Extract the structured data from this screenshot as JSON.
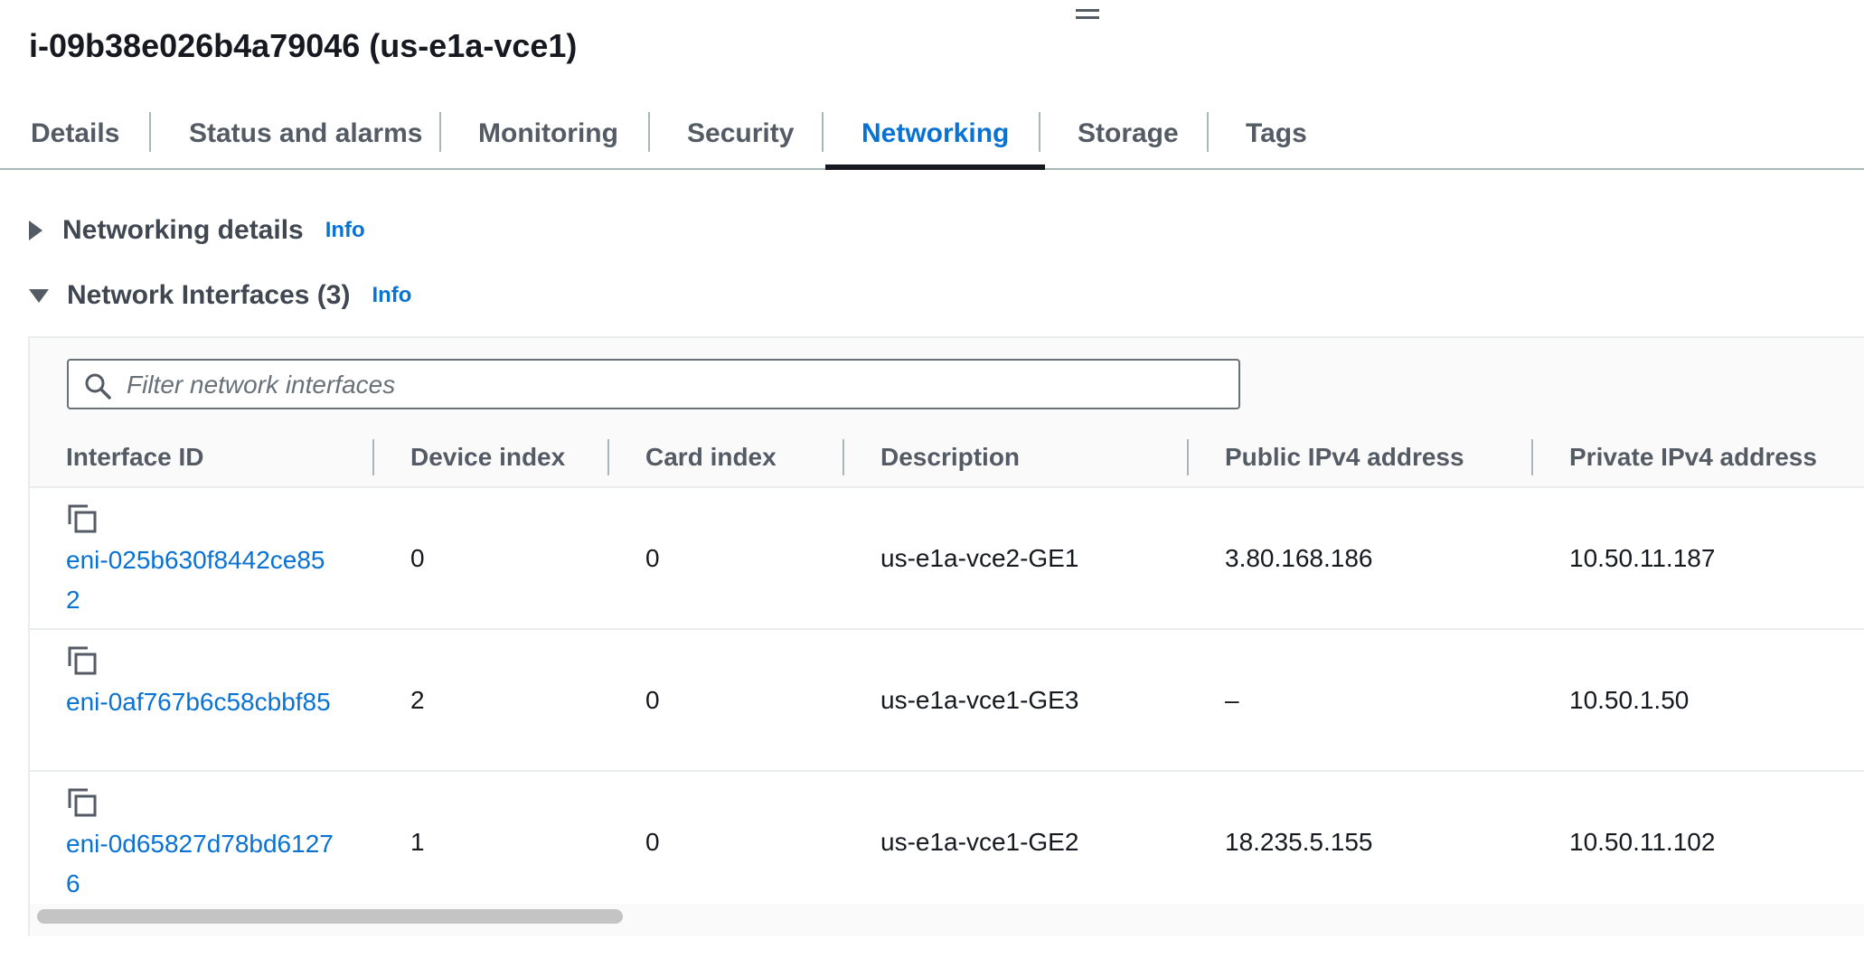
{
  "instance": {
    "title": "i-09b38e026b4a79046 (us-e1a-vce1)"
  },
  "tabs": [
    {
      "label": "Details"
    },
    {
      "label": "Status and alarms"
    },
    {
      "label": "Monitoring"
    },
    {
      "label": "Security"
    },
    {
      "label": "Networking",
      "active": true
    },
    {
      "label": "Storage"
    },
    {
      "label": "Tags"
    }
  ],
  "sections": {
    "networking_details": {
      "label": "Networking details",
      "info": "Info",
      "expanded": false
    },
    "network_interfaces": {
      "label": "Network Interfaces (3)",
      "info": "Info",
      "expanded": true
    }
  },
  "filter": {
    "placeholder": "Filter network interfaces",
    "value": ""
  },
  "table": {
    "columns": [
      "Interface ID",
      "Device index",
      "Card index",
      "Description",
      "Public IPv4 address",
      "Private IPv4 address"
    ],
    "rows": [
      {
        "interface_id": "eni-025b630f8442ce852",
        "device_index": "0",
        "card_index": "0",
        "description": "us-e1a-vce2-GE1",
        "public_ipv4": "3.80.168.186",
        "private_ipv4": "10.50.11.187"
      },
      {
        "interface_id": "eni-0af767b6c58cbbf85",
        "device_index": "2",
        "card_index": "0",
        "description": "us-e1a-vce1-GE3",
        "public_ipv4": "–",
        "private_ipv4": "10.50.1.50"
      },
      {
        "interface_id": "eni-0d65827d78bd61276",
        "device_index": "1",
        "card_index": "0",
        "description": "us-e1a-vce1-GE2",
        "public_ipv4": "18.235.5.155",
        "private_ipv4": "10.50.11.102"
      }
    ]
  },
  "icons": {
    "copy": "copy-icon",
    "search": "search-icon",
    "caret_right": "caret-right-icon",
    "caret_down": "caret-down-icon"
  },
  "colors": {
    "accent": "#0972d3",
    "text": "#16191f",
    "muted": "#545b64",
    "border": "#aab7b8"
  }
}
